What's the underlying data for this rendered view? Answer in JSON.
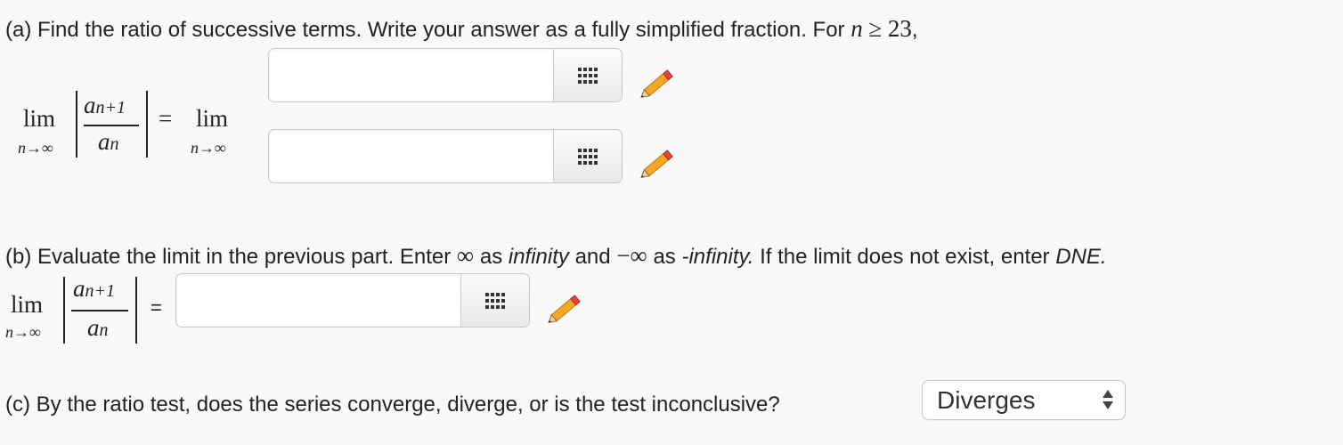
{
  "part_a": {
    "prompt": "(a) Find the ratio of successive terms. Write your answer as a fully simplified fraction. For",
    "condition_var": "n",
    "condition_op": "≥",
    "condition_num": "23",
    "condition_end": ","
  },
  "part_b": {
    "t1": "(b) Evaluate the limit in the previous part. Enter",
    "inf1": "∞",
    "t2": "as",
    "infinity_word": "infinity",
    "t3": "and",
    "neg_inf": "−∞",
    "t4": "as",
    "neg_infinity_word": "-infinity.",
    "t5": "If the limit does not exist, enter",
    "dne": "DNE."
  },
  "part_c": {
    "prompt": "(c) By the ratio test, does the series converge, diverge, or is the test inconclusive?",
    "selected": "Diverges"
  },
  "math": {
    "lim": "lim",
    "lim_sub": "n→∞",
    "numerator": "a",
    "numerator_sub": "n+1",
    "denominator": "a",
    "denominator_sub": "n",
    "equals": "="
  },
  "colors": {
    "pencil_body": "#f5a623",
    "pencil_tip": "#e8423f"
  }
}
